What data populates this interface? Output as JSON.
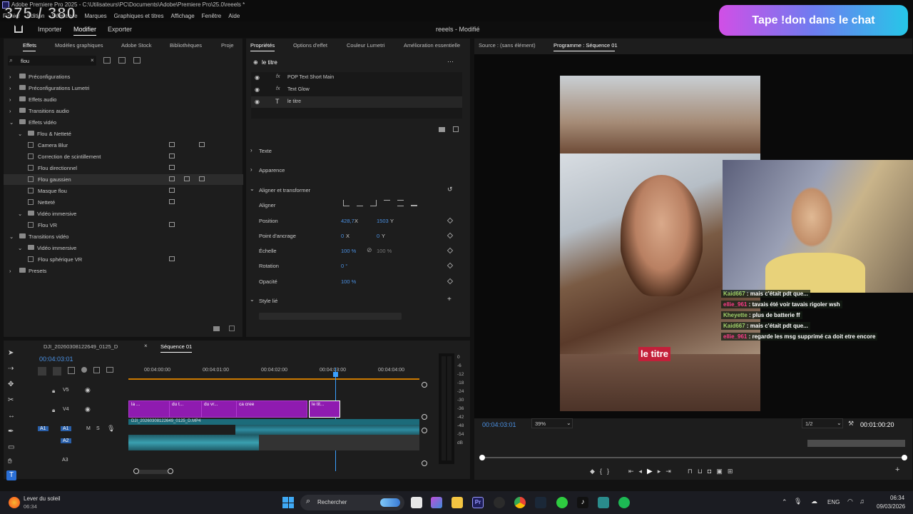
{
  "window": {
    "title": "Adobe Premiere Pro 2025 - C:\\Utilisateurs\\PC\\Documents\\Adobe\\Premiere Pro\\25.0\\reeels *"
  },
  "overlay": {
    "number": "375 / 380",
    "donate": "Tape !don dans le chat"
  },
  "menu": [
    "Fichier",
    "Édition",
    "Séquence",
    "Marques",
    "Graphiques et titres",
    "Affichage",
    "Fenêtre",
    "Aide"
  ],
  "workspace": {
    "importer": "Importer",
    "modifier": "Modifier",
    "exporter": "Exporter",
    "project": "reeels - Modifié"
  },
  "effects_panel": {
    "tabs": [
      "Effets",
      "Modèles graphiques",
      "Adobe Stock",
      "Bibliothèques",
      "Proje"
    ],
    "search_value": "flou",
    "tree": [
      {
        "label": "Préconfigurations",
        "level": 0,
        "type": "folder"
      },
      {
        "label": "Préconfigurations Lumetri",
        "level": 0,
        "type": "folder"
      },
      {
        "label": "Effets audio",
        "level": 0,
        "type": "folder"
      },
      {
        "label": "Transitions audio",
        "level": 0,
        "type": "folder"
      },
      {
        "label": "Effets vidéo",
        "level": 0,
        "type": "folder"
      },
      {
        "label": "Flou & Netteté",
        "level": 1,
        "type": "folder"
      },
      {
        "label": "Camera Blur",
        "level": 2,
        "type": "fx"
      },
      {
        "label": "Correction de scintillement",
        "level": 2,
        "type": "fx"
      },
      {
        "label": "Flou directionnel",
        "level": 2,
        "type": "fx"
      },
      {
        "label": "Flou gaussien",
        "level": 2,
        "type": "fx"
      },
      {
        "label": "Masque flou",
        "level": 2,
        "type": "fx"
      },
      {
        "label": "Netteté",
        "level": 2,
        "type": "fx"
      },
      {
        "label": "Vidéo immersive",
        "level": 1,
        "type": "folder"
      },
      {
        "label": "Flou VR",
        "level": 2,
        "type": "fx"
      },
      {
        "label": "Transitions vidéo",
        "level": 0,
        "type": "folder"
      },
      {
        "label": "Vidéo immersive",
        "level": 1,
        "type": "folder"
      },
      {
        "label": "Flou sphérique VR",
        "level": 2,
        "type": "fx"
      },
      {
        "label": "Presets",
        "level": 0,
        "type": "folder"
      }
    ]
  },
  "properties_panel": {
    "tabs": [
      "Propriétés",
      "Options d'effet",
      "Couleur Lumetri",
      "Amélioration essentielle"
    ],
    "header": "le titre",
    "layers": [
      "POP Text Short Main",
      "Text Glow",
      "le titre"
    ],
    "sections": {
      "texte": "Texte",
      "apparence": "Apparence",
      "aligner": "Aligner et transformer",
      "style": "Style lié"
    },
    "props": {
      "aligner": "Aligner",
      "position": "Position",
      "pos_x": "428,7",
      "x_unit": "X",
      "pos_y": "1503",
      "y_unit": "Y",
      "ancrage": "Point d'ancrage",
      "anc_x": "0",
      "anc_y": "0",
      "echelle": "Échelle",
      "ech_value": "100 %",
      "ech_value2": "100 %",
      "rotation": "Rotation",
      "rot_value": "0 °",
      "opacite": "Opacité",
      "op_value": "100 %"
    }
  },
  "program_monitor": {
    "source_tab": "Source : (sans élément)",
    "program_tab": "Programme : Séquence 01",
    "timecode": "00:04:03:01",
    "zoom": "39%",
    "quality": "1/2",
    "duration": "00:01:00:20",
    "title_overlay": "le titre"
  },
  "chat": [
    {
      "user": "Kaid667",
      "msg": "mais c'était pdt que...",
      "color": "#9fd06a"
    },
    {
      "user": "ellie_961",
      "msg": "tavais été voir tavais rigoler wsh",
      "color": "#ff3b8a"
    },
    {
      "user": "Kheyette",
      "msg": "plus de batterie ff",
      "color": "#9fd06a"
    },
    {
      "user": "Kaid667",
      "msg": "mais c'était pdt que...",
      "color": "#9fd06a"
    },
    {
      "user": "ellie_961",
      "msg": "regarde les msg supprimé ca doit etre encore",
      "color": "#ff3b8a"
    }
  ],
  "timeline": {
    "tabs": [
      "DJI_20260308122649_0125_D",
      "Séquence 01"
    ],
    "timecode": "00:04:03:01",
    "ruler": [
      "00:04:00:00",
      "00:04:01:00",
      "00:04:02:00",
      "00:04:03:00",
      "00:04:04:00"
    ],
    "tracks": [
      "V5",
      "V4",
      "A1",
      "A2",
      "A3"
    ],
    "clips": [
      "la ...",
      "du t...",
      "du vr...",
      "ca cree",
      "le tit..."
    ],
    "audio_clip": "DJI_20260308122649_0125_D.MP4",
    "meter": [
      "0",
      "-6",
      "-12",
      "-18",
      "-24",
      "-30",
      "-36",
      "-42",
      "-48",
      "-54",
      "dB"
    ]
  },
  "taskbar": {
    "weather": "Lever du soleil",
    "weather_time": "06:34",
    "search": "Rechercher",
    "lang": "ENG",
    "time": "06:34",
    "date": "09/03/2026"
  }
}
